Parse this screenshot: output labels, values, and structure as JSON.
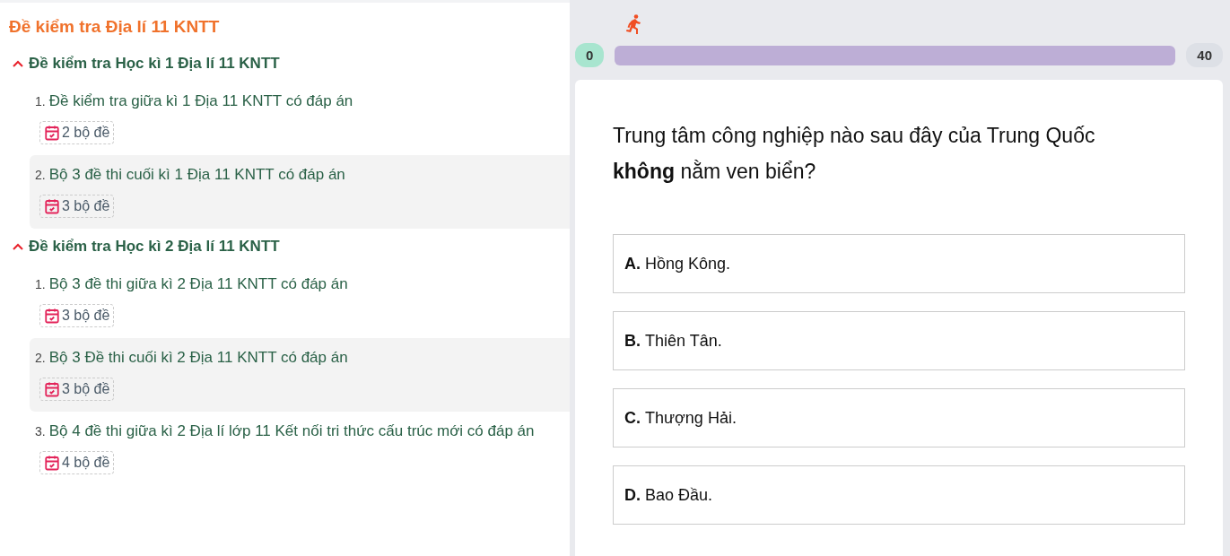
{
  "title": "Đề kiểm tra Địa lí 11 KNTT",
  "sections": [
    {
      "title": "Đề kiểm tra Học kì 1 Địa lí 11 KNTT",
      "expanded": true,
      "items": [
        {
          "number": "1.",
          "title": "Đề kiểm tra giữa kì 1 Địa 11 KNTT có đáp án",
          "badge": "2 bộ đề",
          "selected": false
        },
        {
          "number": "2.",
          "title": "Bộ 3 đề thi cuối kì 1 Địa 11 KNTT có đáp án",
          "badge": "3 bộ đề",
          "selected": true
        }
      ]
    },
    {
      "title": "Đề kiểm tra Học kì 2 Địa lí 11 KNTT",
      "expanded": true,
      "items": [
        {
          "number": "1.",
          "title": "Bộ 3 đề thi giữa kì 2 Địa 11 KNTT có đáp án",
          "badge": "3 bộ đề",
          "selected": false
        },
        {
          "number": "2.",
          "title": "Bộ 3 Đề thi cuối kì 2 Địa 11 KNTT có đáp án",
          "badge": "3 bộ đề",
          "selected": true
        },
        {
          "number": "3.",
          "title": "Bộ 4 đề thi giữa kì 2 Địa lí lớp 11 Kết nối tri thức cấu trúc mới có đáp án",
          "badge": "4 bộ đề",
          "selected": false
        }
      ]
    }
  ],
  "quiz": {
    "progress": {
      "start": "0",
      "end": "40"
    },
    "question": "Trung tâm công nghiệp nào sau đây của Trung Quốc **không** nằm ven biển?",
    "answers": [
      {
        "letter": "A.",
        "text": "Hồng Kông."
      },
      {
        "letter": "B.",
        "text": "Thiên Tân."
      },
      {
        "letter": "C.",
        "text": "Thượng Hải."
      },
      {
        "letter": "D.",
        "text": "Bao Đầu."
      }
    ]
  }
}
